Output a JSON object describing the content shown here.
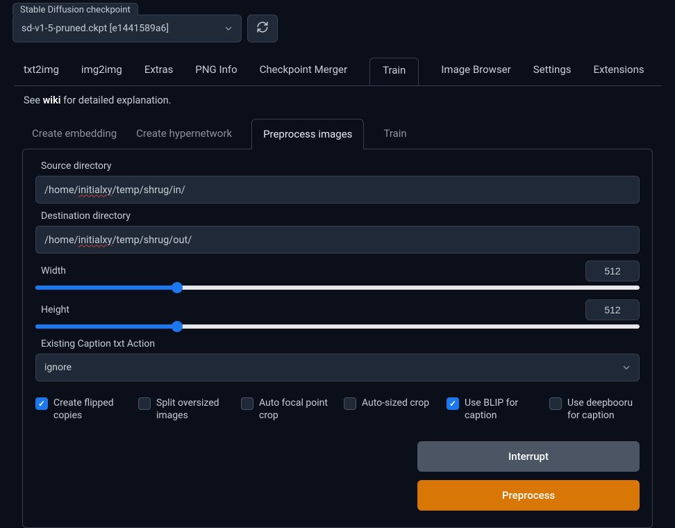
{
  "checkpoint": {
    "label": "Stable Diffusion checkpoint",
    "value": "sd-v1-5-pruned.ckpt [e1441589a6]"
  },
  "main_tabs": [
    "txt2img",
    "img2img",
    "Extras",
    "PNG Info",
    "Checkpoint Merger",
    "Train",
    "Image Browser",
    "Settings",
    "Extensions"
  ],
  "wiki": {
    "prefix": "See ",
    "bold": "wiki",
    "suffix": " for detailed explanation."
  },
  "sub_tabs": [
    "Create embedding",
    "Create hypernetwork",
    "Preprocess images",
    "Train"
  ],
  "fields": {
    "src_label": "Source directory",
    "src_value_pre": "/home/",
    "src_value_mark": "initialxy",
    "src_value_post": "/temp/shrug/in/",
    "dst_label": "Destination directory",
    "dst_value_pre": "/home/",
    "dst_value_mark": "initialxy",
    "dst_value_post": "/temp/shrug/out/",
    "width_label": "Width",
    "width_value": "512",
    "height_label": "Height",
    "height_value": "512",
    "caption_action_label": "Existing Caption txt Action",
    "caption_action_value": "ignore"
  },
  "checks": {
    "flipped": "Create flipped copies",
    "split": "Split oversized images",
    "autofocal": "Auto focal point crop",
    "autosized": "Auto-sized crop",
    "blip": "Use BLIP for caption",
    "deepbooru": "Use deepbooru for caption"
  },
  "buttons": {
    "interrupt": "Interrupt",
    "preprocess": "Preprocess"
  }
}
